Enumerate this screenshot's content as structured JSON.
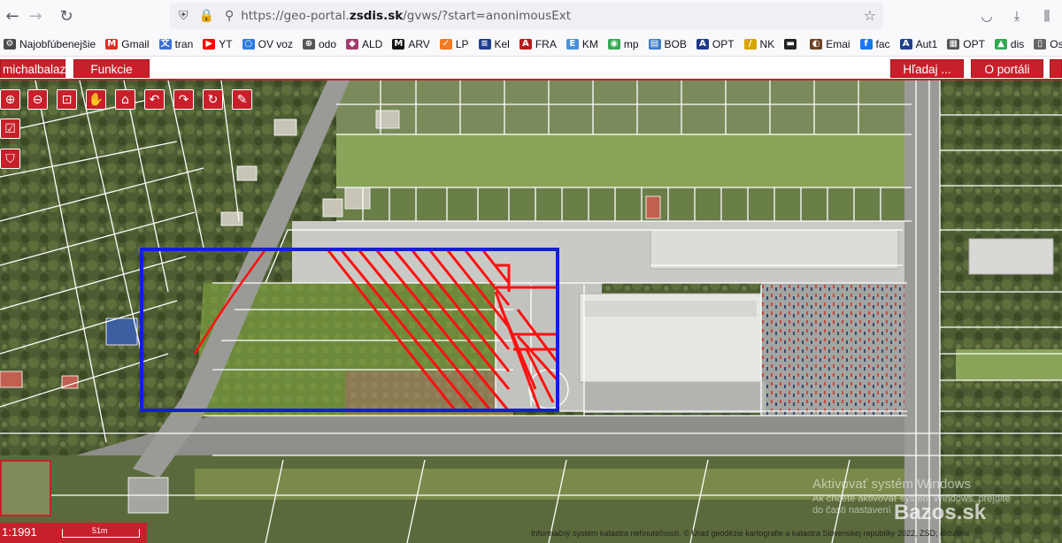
{
  "browser": {
    "nav": {
      "back_icon": "←",
      "forward_icon": "→",
      "reload_icon": "↻"
    },
    "url_prefix": "https://geo-portal.",
    "url_host": "zsdis.sk",
    "url_path": "/gvws/?start=anonimousExt"
  },
  "bookmarks": [
    {
      "label": "Najobľúbenejšie",
      "color": "#4a4a4a",
      "glyph": "⚙"
    },
    {
      "label": "Gmail",
      "color": "#d93025",
      "glyph": "M"
    },
    {
      "label": "tran",
      "color": "#3b6fd6",
      "glyph": "文"
    },
    {
      "label": "YT",
      "color": "#ff0000",
      "glyph": "▶"
    },
    {
      "label": "OV voz",
      "color": "#2c7be5",
      "glyph": "○"
    },
    {
      "label": "odo",
      "color": "#555555",
      "glyph": "⊕"
    },
    {
      "label": "ALD",
      "color": "#a23d6e",
      "glyph": "◆"
    },
    {
      "label": "ARV",
      "color": "#111111",
      "glyph": "M"
    },
    {
      "label": "LP",
      "color": "#f47b20",
      "glyph": "✓"
    },
    {
      "label": "Kel",
      "color": "#1f3f8f",
      "glyph": "≡"
    },
    {
      "label": "FRA",
      "color": "#b71c1c",
      "glyph": "A"
    },
    {
      "label": "KM",
      "color": "#4a90d9",
      "glyph": "E"
    },
    {
      "label": "mp",
      "color": "#34a853",
      "glyph": "◉"
    },
    {
      "label": "BOB",
      "color": "#3d7cc9",
      "glyph": "▤"
    },
    {
      "label": "OPT",
      "color": "#1e3a8a",
      "glyph": "A"
    },
    {
      "label": "NK",
      "color": "#d9a400",
      "glyph": "/"
    },
    {
      "label": "",
      "color": "#222222",
      "glyph": "▬"
    },
    {
      "label": "Emai",
      "color": "#6b4226",
      "glyph": "◐"
    },
    {
      "label": "fac",
      "color": "#1877f2",
      "glyph": "f"
    },
    {
      "label": "Aut1",
      "color": "#1f3f8f",
      "glyph": "A"
    },
    {
      "label": "OPT",
      "color": "#555555",
      "glyph": "▦"
    },
    {
      "label": "dis",
      "color": "#34a853",
      "glyph": "▲"
    },
    {
      "label": "Os",
      "color": "#666666",
      "glyph": "▯"
    }
  ],
  "app": {
    "user_label": "michalbalaz",
    "functions_label": "Funkcie",
    "search_label": "Hľadaj ...",
    "about_label": "O portáli"
  },
  "map": {
    "scale": "1:1991",
    "scale_bar_label": "51m",
    "copyright": "Informačný systém katastra nehnuteľností, © Úrad geodézie kartografie a katastra Slovenskej republiky 2022, ZSD; aktuálne",
    "watermark_title": "Aktivovať systém Windows",
    "watermark_sub": "Ak chcete aktivovať systém Windows, prejdite do časti nastavení",
    "site_watermark": "Bazos.sk",
    "tools": [
      {
        "name": "zoom-in-icon",
        "glyph": "⊕"
      },
      {
        "name": "zoom-out-icon",
        "glyph": "⊖"
      },
      {
        "name": "zoom-box-icon",
        "glyph": "⊡"
      },
      {
        "name": "pan-hand-icon",
        "glyph": "✋"
      },
      {
        "name": "full-extent-icon",
        "glyph": "⌂"
      },
      {
        "name": "undo-icon",
        "glyph": "↶"
      },
      {
        "name": "redo-icon",
        "glyph": "↷"
      },
      {
        "name": "refresh-icon",
        "glyph": "↻"
      },
      {
        "name": "erase-icon",
        "glyph": "✎"
      },
      {
        "name": "select-icon",
        "glyph": "☑"
      },
      {
        "name": "basket-icon",
        "glyph": "⛉"
      }
    ]
  }
}
